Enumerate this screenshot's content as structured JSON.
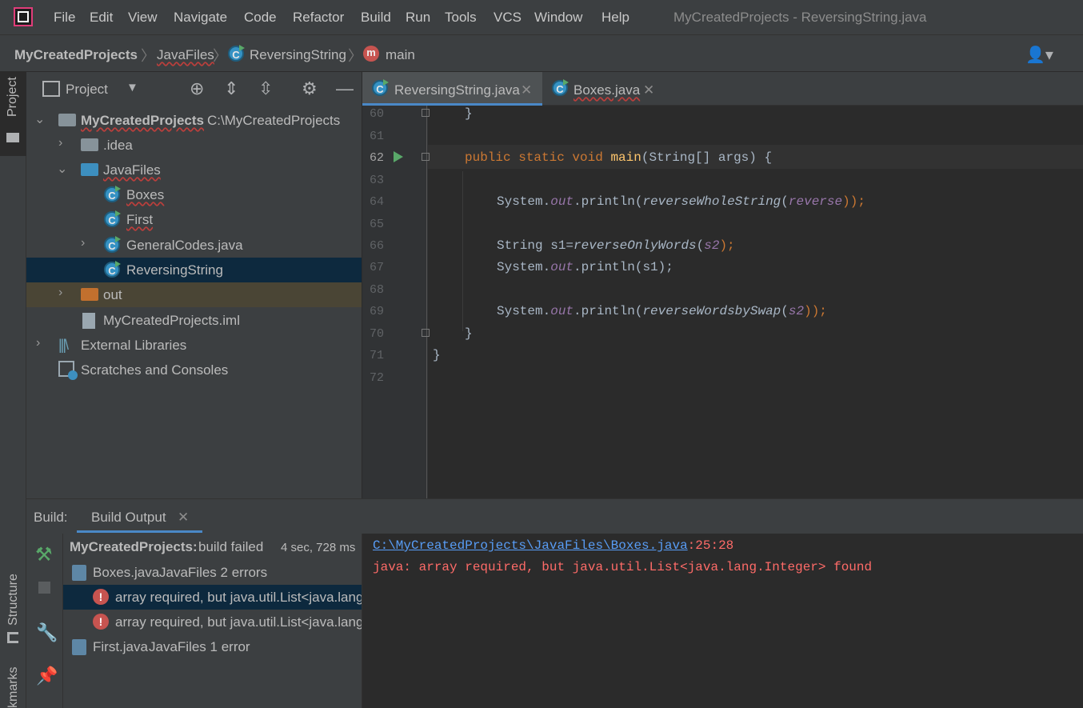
{
  "menu": {
    "items": [
      "File",
      "Edit",
      "View",
      "Navigate",
      "Code",
      "Refactor",
      "Build",
      "Run",
      "Tools",
      "VCS",
      "Window",
      "Help"
    ],
    "window_title": "MyCreatedProjects - ReversingString.java"
  },
  "breadcrumb": [
    "MyCreatedProjects",
    "JavaFiles",
    "ReversingString",
    "main"
  ],
  "project_panel": {
    "title": "Project",
    "tree": [
      {
        "label": "MyCreatedProjects",
        "path": "C:\\MyCreatedProjects"
      },
      {
        "label": ".idea"
      },
      {
        "label": "JavaFiles"
      },
      {
        "label": "Boxes"
      },
      {
        "label": "First"
      },
      {
        "label": "GeneralCodes.java"
      },
      {
        "label": "ReversingString"
      },
      {
        "label": "out"
      },
      {
        "label": "MyCreatedProjects.iml"
      },
      {
        "label": "External Libraries"
      },
      {
        "label": "Scratches and Consoles"
      }
    ]
  },
  "side_tabs": {
    "project": "Project",
    "structure": "Structure",
    "bookmarks": "kmarks"
  },
  "editor": {
    "tabs": [
      {
        "label": "ReversingString.java"
      },
      {
        "label": "Boxes.java"
      }
    ],
    "line_numbers": [
      "60",
      "61",
      "62",
      "63",
      "64",
      "65",
      "66",
      "67",
      "68",
      "69",
      "70",
      "71",
      "72"
    ],
    "lines": {
      "l60": "}",
      "l62_kw": "public static void",
      "l62_fn": "main",
      "l62_rest": "(String[] args) {",
      "l64_a": "System.",
      "l64_out": "out",
      "l64_b": ".println(",
      "l64_m": "reverseWholeString",
      "l64_p": "(",
      "l64_v": "reverse",
      "l64_c": "));",
      "l66_a": "String s1=",
      "l66_m": "reverseOnlyWords",
      "l66_p": "(",
      "l66_v": "s2",
      "l66_c": ");",
      "l67_a": "System.",
      "l67_out": "out",
      "l67_b": ".println(s1);",
      "l69_a": "System.",
      "l69_out": "out",
      "l69_b": ".println(",
      "l69_m": "reverseWordsbySwap",
      "l69_p": "(",
      "l69_v": "s2",
      "l69_c": "));",
      "l70": "}",
      "l71": "}"
    }
  },
  "build": {
    "label": "Build:",
    "tab": "Build Output",
    "summary_name": "MyCreatedProjects:",
    "summary_status": "build failed",
    "summary_time": "4 sec, 728 ms",
    "file1": "Boxes.java",
    "file1_meta": "JavaFiles 2 errors",
    "err1": "array required, but java.util.List<java.lang",
    "err2": "array required, but java.util.List<java.lang",
    "file2": "First.java",
    "file2_meta": "JavaFiles 1 error",
    "output_link": "C:\\MyCreatedProjects\\JavaFiles\\Boxes.java",
    "output_pos": ":25:28",
    "output_error": "java: array required, but java.util.List<java.lang.Integer> found"
  }
}
